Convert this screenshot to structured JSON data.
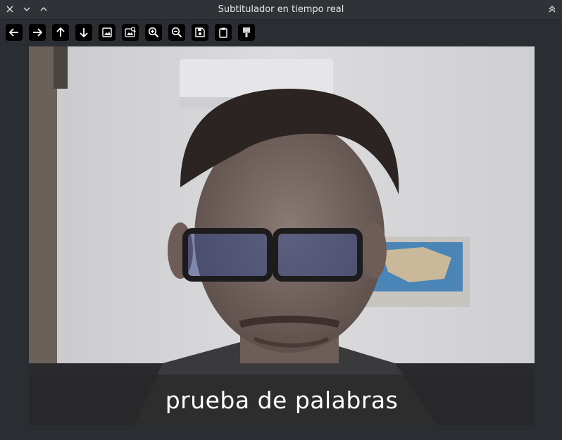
{
  "window": {
    "title": "Subtitulador en tiempo real",
    "controls": [
      "close-icon",
      "minimize-icon",
      "maximize-icon"
    ],
    "right_control": "keep-above-icon"
  },
  "toolbar": {
    "tools": [
      {
        "name": "arrow-left-icon"
      },
      {
        "name": "arrow-right-icon"
      },
      {
        "name": "arrow-up-icon"
      },
      {
        "name": "arrow-down-icon"
      },
      {
        "name": "image-icon"
      },
      {
        "name": "image-search-icon"
      },
      {
        "name": "zoom-in-icon"
      },
      {
        "name": "zoom-out-icon"
      },
      {
        "name": "save-icon"
      },
      {
        "name": "clipboard-icon"
      },
      {
        "name": "paint-brush-icon"
      }
    ]
  },
  "video": {
    "caption": "prueba de palabras"
  },
  "colors": {
    "window_bg": "#2a2e32",
    "titlebar_bg": "#2f3337",
    "button_bg": "#000000",
    "caption_bg": "rgba(40,40,42,0.72)",
    "caption_text": "#ffffff"
  }
}
